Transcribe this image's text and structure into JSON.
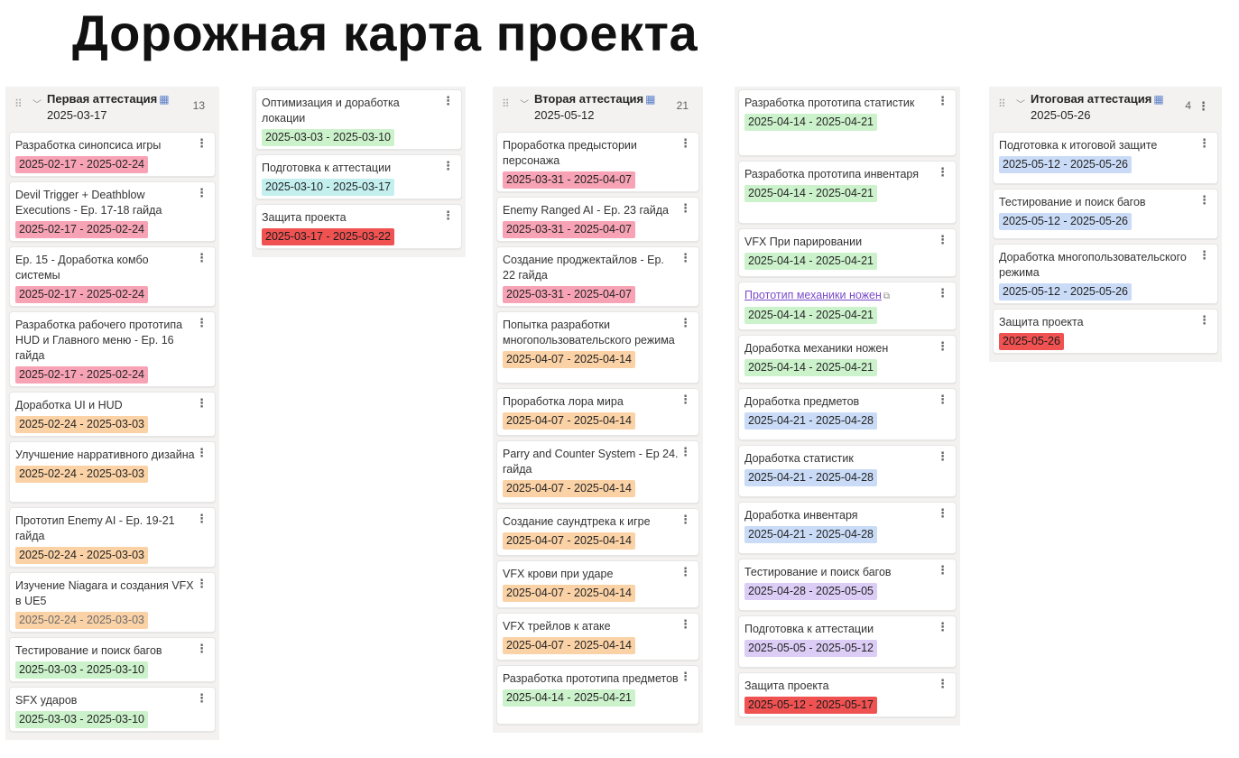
{
  "page": {
    "title": "Дорожная карта проекта"
  },
  "columns": [
    {
      "id": "c1",
      "header": {
        "title": "Первая аттестация",
        "date": "2025-03-17",
        "count": "13",
        "show_more": false
      },
      "cards": [
        {
          "title": "Разработка синопсиса игры",
          "dates": "2025-02-17 - 2025-02-24",
          "color": "pink"
        },
        {
          "title": "Devil Trigger + Deathblow Executions - Ep. 17-18 гайда",
          "dates": "2025-02-17 - 2025-02-24",
          "color": "pink"
        },
        {
          "title": "Ep. 15 - Доработка комбо системы",
          "dates": "2025-02-17 - 2025-02-24",
          "color": "pink"
        },
        {
          "title": "Разработка рабочего прототипа HUD и Главного меню - Ep. 16 гайда",
          "dates": "2025-02-17 - 2025-02-24",
          "color": "pink"
        },
        {
          "title": "Доработка UI и HUD",
          "dates": "2025-02-24 - 2025-03-03",
          "color": "orange"
        },
        {
          "title": "Улучшение нарративного дизайна",
          "dates": "2025-02-24 - 2025-03-03",
          "color": "orange"
        },
        {
          "title": "Прототип Enemy AI - Ep. 19-21 гайда",
          "dates": "2025-02-24 - 2025-03-03",
          "color": "orange"
        },
        {
          "title": "Изучение Niagara и создания VFX в UE5",
          "dates": "2025-02-24 - 2025-03-03",
          "color": "orange",
          "faded": true
        },
        {
          "title": "Тестирование и поиск багов",
          "dates": "2025-03-03 - 2025-03-10",
          "color": "green"
        },
        {
          "title": "SFX ударов",
          "dates": "2025-03-03 - 2025-03-10",
          "color": "green"
        }
      ]
    },
    {
      "id": "c2",
      "header": null,
      "cards": [
        {
          "title": "Оптимизация и доработка локации",
          "dates": "2025-03-03 - 2025-03-10",
          "color": "green"
        },
        {
          "title": "Подготовка к аттестации",
          "dates": "2025-03-10 - 2025-03-17",
          "color": "cyan"
        },
        {
          "title": "Защита проекта",
          "dates": "2025-03-17 - 2025-03-22",
          "color": "red"
        }
      ]
    },
    {
      "id": "c3",
      "header": {
        "title": "Вторая аттестация",
        "date": "2025-05-12",
        "count": "21",
        "show_more": false
      },
      "cards": [
        {
          "title": "Проработка предыстории персонажа",
          "dates": "2025-03-31 - 2025-04-07",
          "color": "pink"
        },
        {
          "title": "Enemy Ranged AI - Ep. 23 гайда",
          "dates": "2025-03-31 - 2025-04-07",
          "color": "pink"
        },
        {
          "title": "Создание проджектайлов - Ep. 22 гайда",
          "dates": "2025-03-31 - 2025-04-07",
          "color": "pink"
        },
        {
          "title": "Попытка разработки многопользовательского режима",
          "dates": "2025-04-07 - 2025-04-14",
          "color": "orange"
        },
        {
          "title": "Проработка лора мира",
          "dates": "2025-04-07 - 2025-04-14",
          "color": "orange"
        },
        {
          "title": "Parry and Counter System - Ep 24. гайда",
          "dates": "2025-04-07 - 2025-04-14",
          "color": "orange"
        },
        {
          "title": "Создание саундтрека к игре",
          "dates": "2025-04-07 - 2025-04-14",
          "color": "orange"
        },
        {
          "title": "VFX крови при ударе",
          "dates": "2025-04-07 - 2025-04-14",
          "color": "orange"
        },
        {
          "title": "VFX трейлов к атаке",
          "dates": "2025-04-07 - 2025-04-14",
          "color": "orange"
        },
        {
          "title": "Разработка прототипа предметов",
          "dates": "2025-04-14 - 2025-04-21",
          "color": "green"
        }
      ]
    },
    {
      "id": "c4",
      "header": null,
      "cards": [
        {
          "title": "Разработка прототипа статистик",
          "dates": "2025-04-14 - 2025-04-21",
          "color": "green"
        },
        {
          "title": "Разработка прототипа инвентаря",
          "dates": "2025-04-14 - 2025-04-21",
          "color": "green"
        },
        {
          "title": "VFX При парировании",
          "dates": "2025-04-14 - 2025-04-21",
          "color": "green"
        },
        {
          "title": "Прототип механики ножен",
          "dates": "2025-04-14 - 2025-04-21",
          "color": "green",
          "link": true
        },
        {
          "title": "Доработка механики ножен",
          "dates": "2025-04-14 - 2025-04-21",
          "color": "green"
        },
        {
          "title": "Доработка предметов",
          "dates": "2025-04-21 - 2025-04-28",
          "color": "blue"
        },
        {
          "title": "Доработка статистик",
          "dates": "2025-04-21 - 2025-04-28",
          "color": "blue"
        },
        {
          "title": "Доработка инвентаря",
          "dates": "2025-04-21 - 2025-04-28",
          "color": "blue"
        },
        {
          "title": "Тестирование и поиск багов",
          "dates": "2025-04-28 - 2025-05-05",
          "color": "purple"
        },
        {
          "title": "Подготовка к аттестации",
          "dates": "2025-05-05 - 2025-05-12",
          "color": "purple"
        },
        {
          "title": "Защита проекта",
          "dates": "2025-05-12 - 2025-05-17",
          "color": "red"
        }
      ]
    },
    {
      "id": "c5",
      "header": {
        "title": "Итоговая аттестация",
        "date": "2025-05-26",
        "count": "4",
        "show_more": true
      },
      "cards": [
        {
          "title": "Подготовка к итоговой защите",
          "dates": "2025-05-12 - 2025-05-26",
          "color": "blue"
        },
        {
          "title": "Тестирование и поиск багов",
          "dates": "2025-05-12 - 2025-05-26",
          "color": "blue"
        },
        {
          "title": "Доработка многопользовательского режима",
          "dates": "2025-05-12 - 2025-05-26",
          "color": "blue"
        },
        {
          "title": "Защита проекта",
          "dates": "2025-05-26",
          "color": "red"
        }
      ]
    }
  ]
}
